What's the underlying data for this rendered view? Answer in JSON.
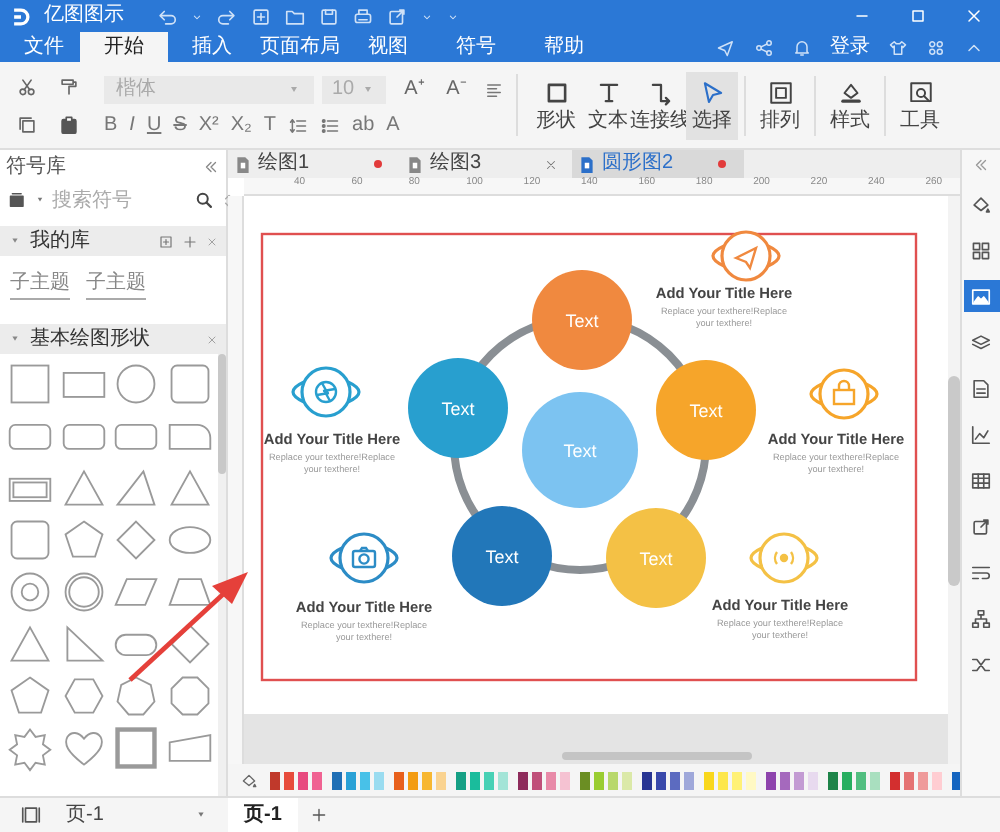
{
  "app": {
    "title": "亿图图示"
  },
  "menu_tabs": [
    {
      "label": "文件",
      "selected": false
    },
    {
      "label": "开始",
      "selected": true
    },
    {
      "label": "插入",
      "selected": false
    },
    {
      "label": "页面布局",
      "selected": false
    },
    {
      "label": "视图",
      "selected": false
    },
    {
      "label": "符号",
      "selected": false
    },
    {
      "label": "帮助",
      "selected": false
    }
  ],
  "account": {
    "login": "登录"
  },
  "ribbon": {
    "font": "楷体",
    "font_size": "10",
    "size_buttons": [
      "A⁺",
      "A⁻"
    ],
    "format_buttons": [
      "B",
      "I",
      "U",
      "S",
      "X²",
      "X₂",
      "T"
    ],
    "case_button": "ab",
    "color_button": "A",
    "tools": [
      {
        "label": "形状",
        "kind": "shape",
        "selected": false
      },
      {
        "label": "文本",
        "kind": "text",
        "selected": false
      },
      {
        "label": "连接线",
        "kind": "connector",
        "selected": false
      },
      {
        "label": "选择",
        "kind": "select",
        "selected": true
      },
      {
        "label": "排列",
        "kind": "arrange",
        "selected": false
      },
      {
        "label": "样式",
        "kind": "style",
        "selected": false
      },
      {
        "label": "工具",
        "kind": "tools",
        "selected": false
      }
    ]
  },
  "library": {
    "title": "符号库",
    "search_placeholder": "搜索符号",
    "my_library": {
      "title": "我的库",
      "items": [
        "子主题",
        "子主题"
      ]
    },
    "basic_shapes": {
      "title": "基本绘图形状",
      "shapes": [
        {
          "kind": "square"
        },
        {
          "kind": "rectangle"
        },
        {
          "kind": "circle"
        },
        {
          "kind": "rounded-square"
        },
        {
          "kind": "rounded-rectangle"
        },
        {
          "kind": "rounded-rectangle"
        },
        {
          "kind": "rounded-rectangle"
        },
        {
          "kind": "tab"
        },
        {
          "kind": "frame"
        },
        {
          "kind": "triangle"
        },
        {
          "kind": "slant-triangle"
        },
        {
          "kind": "triangle"
        },
        {
          "kind": "rounded-square"
        },
        {
          "kind": "pentagon"
        },
        {
          "kind": "diamond"
        },
        {
          "kind": "ellipse"
        },
        {
          "kind": "ring"
        },
        {
          "kind": "double-ring"
        },
        {
          "kind": "parallelogram"
        },
        {
          "kind": "trapezoid"
        },
        {
          "kind": "triangle"
        },
        {
          "kind": "right-triangle"
        },
        {
          "kind": "pill"
        },
        {
          "kind": "diamond"
        },
        {
          "kind": "pentagon"
        },
        {
          "kind": "hexagon"
        },
        {
          "kind": "heptagon"
        },
        {
          "kind": "octagon"
        },
        {
          "kind": "star"
        },
        {
          "kind": "heart"
        },
        {
          "kind": "thick-square"
        },
        {
          "kind": "quad"
        }
      ]
    }
  },
  "doc_tabs": [
    {
      "label": "绘图1",
      "selected": false,
      "modified": true
    },
    {
      "label": "绘图3",
      "selected": false,
      "modified": false
    },
    {
      "label": "圆形图2",
      "selected": true,
      "modified": true
    }
  ],
  "ruler": {
    "ticks": [
      "40",
      "60",
      "80",
      "100",
      "120",
      "140",
      "160",
      "180",
      "200",
      "220",
      "240",
      "260"
    ]
  },
  "diagram": {
    "center": {
      "label": "Text",
      "color": "#7cc3f1"
    },
    "nodes": [
      {
        "label": "Text",
        "color": "#f0893f"
      },
      {
        "label": "Text",
        "color": "#289fcf"
      },
      {
        "label": "Text",
        "color": "#f6a52a"
      },
      {
        "label": "Text",
        "color": "#2277b9"
      },
      {
        "label": "Text",
        "color": "#f4c145"
      }
    ],
    "callouts": [
      {
        "kind": "paper-plane",
        "title": "Add Your Title Here",
        "lines": [
          "Replace your texthere!Replace",
          "your texthere!"
        ],
        "color": "#f0893f"
      },
      {
        "kind": "aperture",
        "title": "Add Your Title Here",
        "lines": [
          "Replace your texthere!Replace",
          "your texthere!"
        ],
        "color": "#289fcf"
      },
      {
        "kind": "bag",
        "title": "Add Your Title Here",
        "lines": [
          "Replace your texthere!Replace",
          "your texthere!"
        ],
        "color": "#f6a52a"
      },
      {
        "kind": "camera",
        "title": "Add Your Title Here",
        "lines": [
          "Replace your texthere!Replace",
          "your texthere!"
        ],
        "color": "#2c8cc6"
      },
      {
        "kind": "signal",
        "title": "Add Your Title Here",
        "lines": [
          "Replace your texthere!Replace",
          "your texthere!"
        ],
        "color": "#f4c145"
      }
    ]
  },
  "palette": [
    {
      "color": "#c0392b"
    },
    {
      "color": "#e74c3c"
    },
    {
      "color": "#e84a7f"
    },
    {
      "color": "#f06292"
    },
    {
      "color": "#1f6fb5"
    },
    {
      "color": "#2aa1d6"
    },
    {
      "color": "#48c1e8"
    },
    {
      "color": "#9adcf0"
    },
    {
      "color": "#e8601c"
    },
    {
      "color": "#f39c12"
    },
    {
      "color": "#f7b731"
    },
    {
      "color": "#fad390"
    },
    {
      "color": "#16a085"
    },
    {
      "color": "#1abc9c"
    },
    {
      "color": "#48d1b5"
    },
    {
      "color": "#a3e4d7"
    },
    {
      "color": "#8e2c5c"
    },
    {
      "color": "#c0507a"
    },
    {
      "color": "#e88aa8"
    },
    {
      "color": "#f5c2d2"
    },
    {
      "color": "#6b8e23"
    },
    {
      "color": "#9acd32"
    },
    {
      "color": "#b8d86b"
    },
    {
      "color": "#dbe9a8"
    },
    {
      "color": "#283593"
    },
    {
      "color": "#3949ab"
    },
    {
      "color": "#5c6bc0"
    },
    {
      "color": "#9fa8da"
    },
    {
      "color": "#f9d71c"
    },
    {
      "color": "#fde74c"
    },
    {
      "color": "#fff176"
    },
    {
      "color": "#fff9c4"
    },
    {
      "color": "#8e44ad"
    },
    {
      "color": "#a569bd"
    },
    {
      "color": "#c39bd3"
    },
    {
      "color": "#e8daef"
    },
    {
      "color": "#1e8449"
    },
    {
      "color": "#27ae60"
    },
    {
      "color": "#52be80"
    },
    {
      "color": "#a9dfbf"
    },
    {
      "color": "#d32f2f"
    },
    {
      "color": "#e57373"
    },
    {
      "color": "#ef9a9a"
    },
    {
      "color": "#ffcdd2"
    },
    {
      "color": "#1565c0"
    }
  ],
  "side_tools": [
    {
      "kind": "fill",
      "selected": false
    },
    {
      "kind": "grid",
      "selected": false
    },
    {
      "kind": "image",
      "selected": true
    },
    {
      "kind": "layers",
      "selected": false
    },
    {
      "kind": "page",
      "selected": false
    },
    {
      "kind": "chart",
      "selected": false
    },
    {
      "kind": "table",
      "selected": false
    },
    {
      "kind": "export",
      "selected": false
    },
    {
      "kind": "wrap",
      "selected": false
    },
    {
      "kind": "org",
      "selected": false
    },
    {
      "kind": "shuffle",
      "selected": false
    }
  ],
  "pages": {
    "dropdown": "页-1",
    "tabs": [
      {
        "label": "页-1",
        "selected": true
      }
    ]
  }
}
